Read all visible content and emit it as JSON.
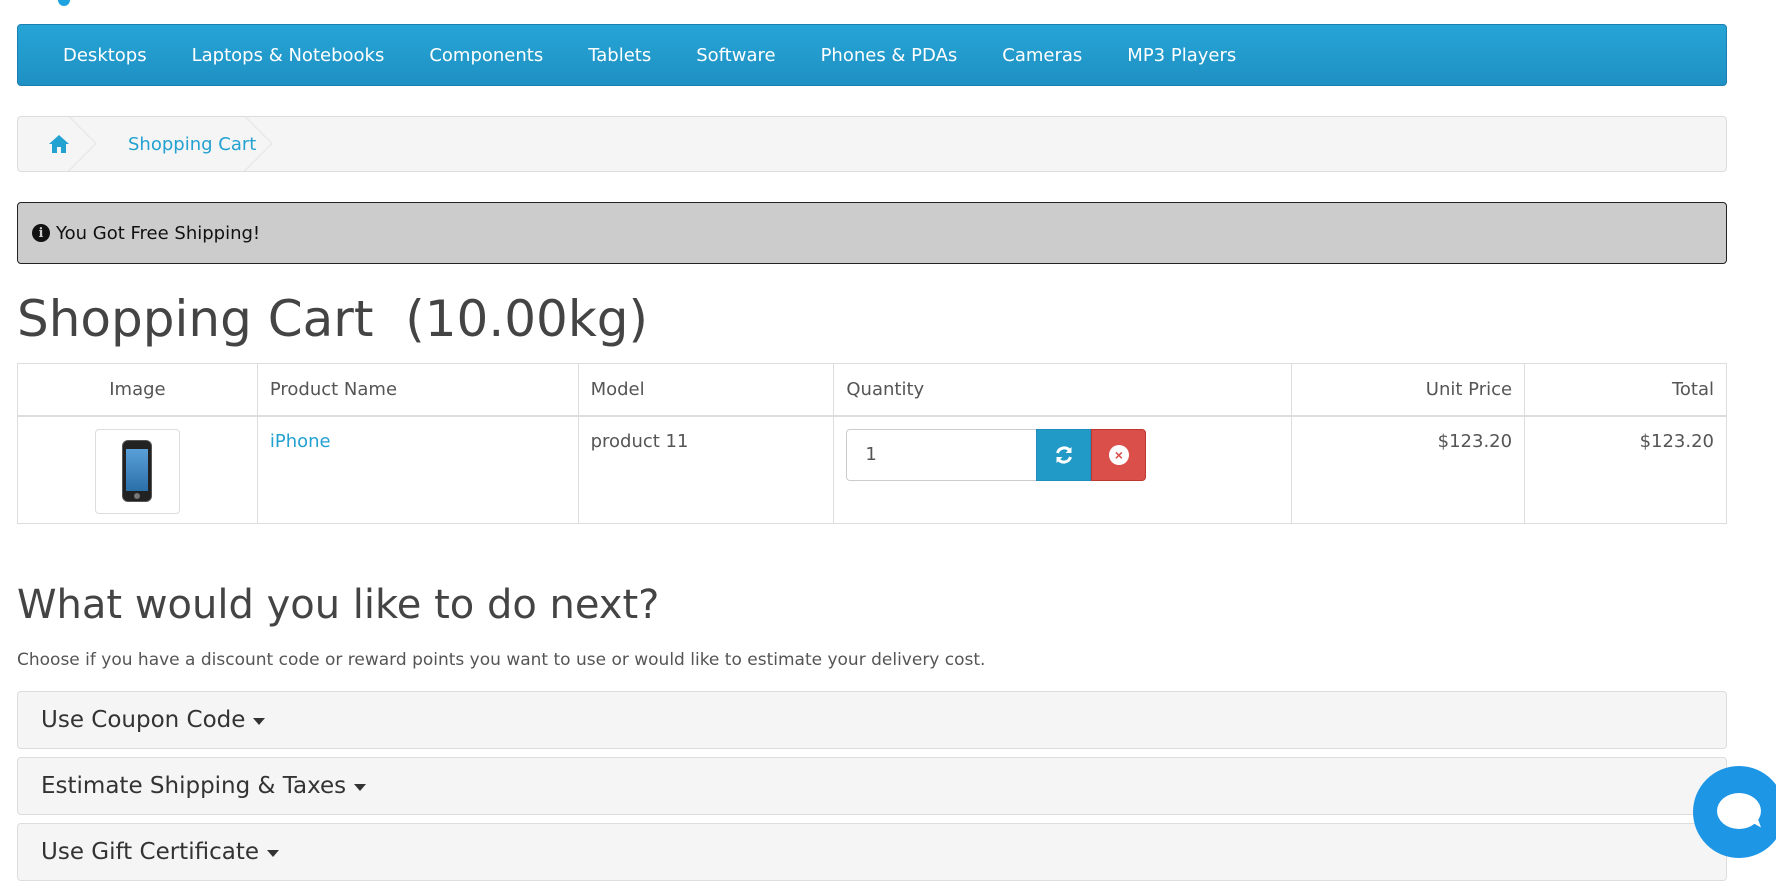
{
  "nav": {
    "items": [
      "Desktops",
      "Laptops & Notebooks",
      "Components",
      "Tablets",
      "Software",
      "Phones & PDAs",
      "Cameras",
      "MP3 Players"
    ]
  },
  "breadcrumb": {
    "home_icon": "home-icon",
    "current": "Shopping Cart"
  },
  "alert": {
    "icon": "info-circle-icon",
    "text": "You Got Free Shipping!"
  },
  "page": {
    "title": "Shopping Cart  (10.00kg)"
  },
  "cart": {
    "headers": {
      "image": "Image",
      "product_name": "Product Name",
      "model": "Model",
      "quantity": "Quantity",
      "unit_price": "Unit Price",
      "total": "Total"
    },
    "rows": [
      {
        "product_name": "iPhone",
        "model": "product 11",
        "quantity": "1",
        "unit_price": "$123.20",
        "total": "$123.20"
      }
    ]
  },
  "next": {
    "title": "What would you like to do next?",
    "description": "Choose if you have a discount code or reward points you want to use or would like to estimate your delivery cost.",
    "panels": [
      "Use Coupon Code",
      "Estimate Shipping & Taxes",
      "Use Gift Certificate"
    ]
  },
  "colors": {
    "accent": "#229ac8",
    "danger": "#da4f49",
    "link": "#23a1d1"
  }
}
